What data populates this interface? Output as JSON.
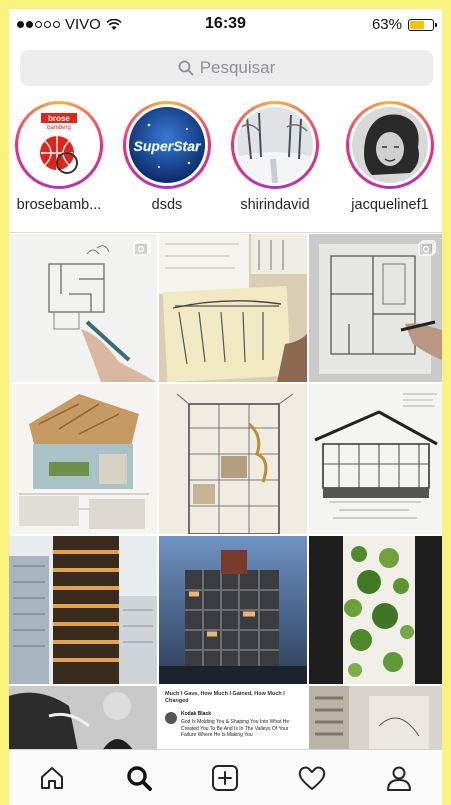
{
  "status_bar": {
    "carrier": "VIVO",
    "time": "16:39",
    "battery_percent": "63%",
    "battery_level": 0.63,
    "signal_bars_filled": 2,
    "battery_color": "#f5c400"
  },
  "search": {
    "placeholder": "Pesquisar",
    "icon": "search-icon"
  },
  "stories": [
    {
      "username": "brosebamb...",
      "ring_colors": [
        "#f7b33a",
        "#ee2a7b",
        "#a437c4"
      ],
      "logo_text": "brose bamberg"
    },
    {
      "username": "dsds",
      "logo_text": "SuperStar"
    },
    {
      "username": "shirindavid"
    },
    {
      "username": "jacquelinef1"
    }
  ],
  "grid": {
    "tweet_cell": {
      "title": "Much I Gave, How Much I Gained, How Much I Changed",
      "tweet_author": "Kodak Black",
      "tweet_text": "God Is Molding You & Shaping You Into What He Created You To Be And Is In The Valleys Of Your Failure Where He Is Making You"
    }
  },
  "tabbar": {
    "items": [
      "home-icon",
      "explore-icon",
      "new-post-icon",
      "activity-icon",
      "profile-icon"
    ],
    "active": "explore-icon"
  },
  "colors": {
    "background": "#fbf27e",
    "accent": "#262626"
  }
}
